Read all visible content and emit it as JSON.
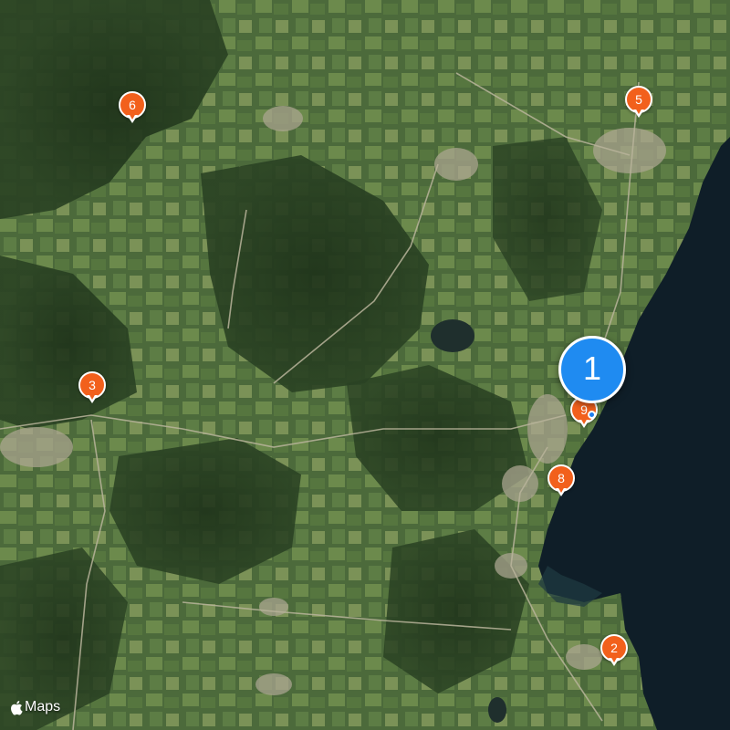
{
  "map": {
    "attribution_text": "Maps",
    "cluster": {
      "count": "1",
      "color": "#1f8bf1"
    },
    "pin_color": "#f2601c",
    "pins": [
      {
        "label": "2"
      },
      {
        "label": "3"
      },
      {
        "label": "5"
      },
      {
        "label": "6"
      },
      {
        "label": "8"
      },
      {
        "label": "9"
      }
    ]
  }
}
